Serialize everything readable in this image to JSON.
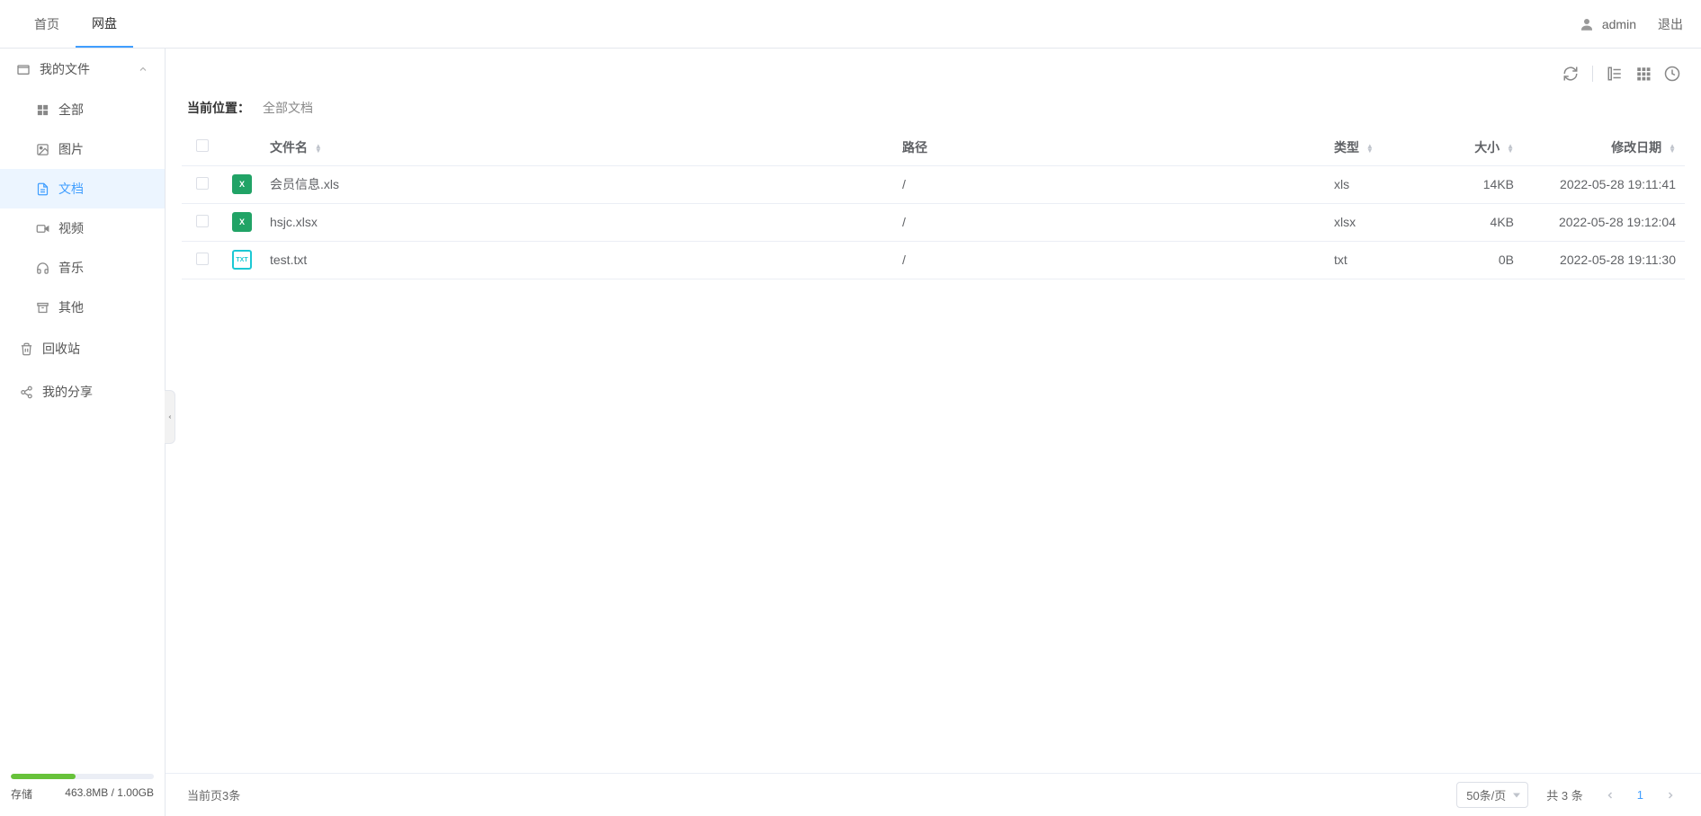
{
  "header": {
    "tabs": [
      {
        "label": "首页",
        "active": false
      },
      {
        "label": "网盘",
        "active": true
      }
    ],
    "user": "admin",
    "logout": "退出"
  },
  "sidebar": {
    "my_files": {
      "label": "我的文件"
    },
    "categories": [
      {
        "label": "全部",
        "icon": "grid"
      },
      {
        "label": "图片",
        "icon": "image"
      },
      {
        "label": "文档",
        "icon": "doc",
        "active": true
      },
      {
        "label": "视频",
        "icon": "video"
      },
      {
        "label": "音乐",
        "icon": "audio"
      },
      {
        "label": "其他",
        "icon": "other"
      }
    ],
    "recycle": {
      "label": "回收站"
    },
    "share": {
      "label": "我的分享"
    },
    "storage": {
      "label": "存储",
      "used_text": "463.8MB / 1.00GB",
      "percent": 45
    }
  },
  "breadcrumb": {
    "label": "当前位置：",
    "path": "全部文档"
  },
  "table": {
    "headers": {
      "name": "文件名",
      "path": "路径",
      "type": "类型",
      "size": "大小",
      "date": "修改日期"
    },
    "rows": [
      {
        "name": "会员信息.xls",
        "path": "/",
        "type": "xls",
        "size": "14KB",
        "date": "2022-05-28 19:11:41",
        "icon": "xls"
      },
      {
        "name": "hsjc.xlsx",
        "path": "/",
        "type": "xlsx",
        "size": "4KB",
        "date": "2022-05-28 19:12:04",
        "icon": "xls"
      },
      {
        "name": "test.txt",
        "path": "/",
        "type": "txt",
        "size": "0B",
        "date": "2022-05-28 19:11:30",
        "icon": "txt"
      }
    ]
  },
  "footer": {
    "current_count": "当前页3条",
    "page_size": "50条/页",
    "total": "共 3 条",
    "page_num": "1"
  }
}
